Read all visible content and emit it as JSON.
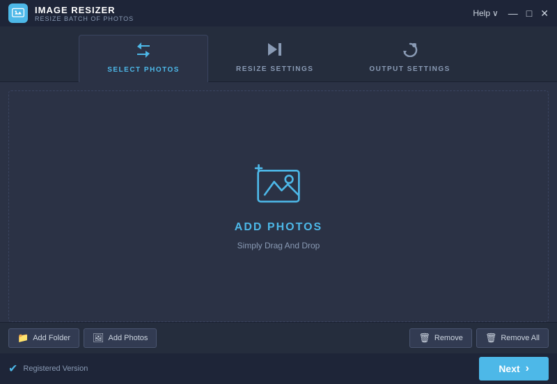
{
  "titleBar": {
    "appName": "IMAGE RESIZER",
    "appSubtitle": "RESIZE BATCH OF PHOTOS",
    "helpLabel": "Help",
    "helpChevron": "∨",
    "controls": {
      "minimize": "—",
      "maximize": "□",
      "close": "✕"
    }
  },
  "tabs": [
    {
      "id": "select-photos",
      "label": "SELECT PHOTOS",
      "icon": "arrows",
      "active": true
    },
    {
      "id": "resize-settings",
      "label": "RESIZE SETTINGS",
      "icon": "skip",
      "active": false
    },
    {
      "id": "output-settings",
      "label": "OUTPUT SETTINGS",
      "icon": "refresh",
      "active": false
    }
  ],
  "dropZone": {
    "addLabel": "ADD PHOTOS",
    "dragLabel": "Simply Drag And Drop"
  },
  "toolbar": {
    "addFolder": "Add Folder",
    "addPhotos": "Add Photos",
    "remove": "Remove",
    "removeAll": "Remove All"
  },
  "statusBar": {
    "registered": "Registered Version",
    "nextLabel": "Next"
  }
}
